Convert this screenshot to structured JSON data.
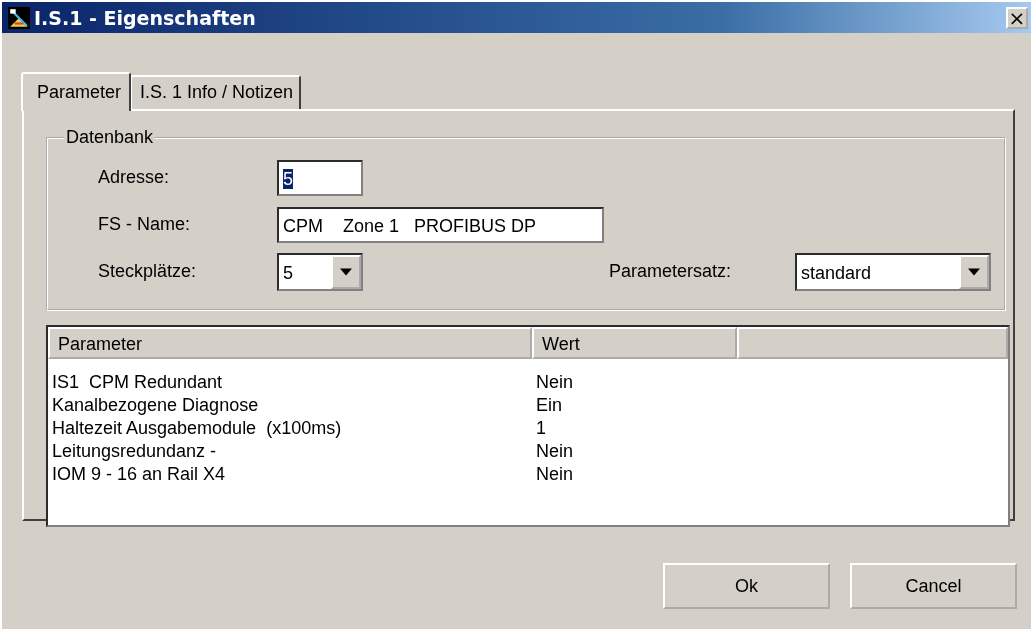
{
  "window": {
    "title": "I.S.1 - Eigenschaften",
    "close": "×"
  },
  "tabs": [
    {
      "label": "Parameter",
      "selected": true
    },
    {
      "label": "I.S. 1 Info / Notizen",
      "selected": false
    }
  ],
  "group": {
    "title": "Datenbank",
    "address": {
      "label": "Adresse:",
      "value": "5",
      "text_selected": true
    },
    "fs_name": {
      "label": "FS - Name:",
      "value": "CPM    Zone 1   PROFIBUS DP"
    },
    "slots": {
      "label": "Steckplätze:",
      "value": "5"
    },
    "parameter_set": {
      "label": "Parametersatz:",
      "value": "standard"
    }
  },
  "table": {
    "columns": [
      "Parameter",
      "Wert"
    ],
    "rows": [
      {
        "parameter": "IS1  CPM Redundant",
        "value": "Nein"
      },
      {
        "parameter": "Kanalbezogene Diagnose",
        "value": "Ein"
      },
      {
        "parameter": "Haltezeit Ausgabemodule  (x100ms)",
        "value": "1"
      },
      {
        "parameter": "Leitungsredundanz -",
        "value": "Nein"
      },
      {
        "parameter": "IOM 9 - 16 an Rail X4",
        "value": "Nein"
      }
    ]
  },
  "buttons": [
    "Ok",
    "Cancel"
  ]
}
